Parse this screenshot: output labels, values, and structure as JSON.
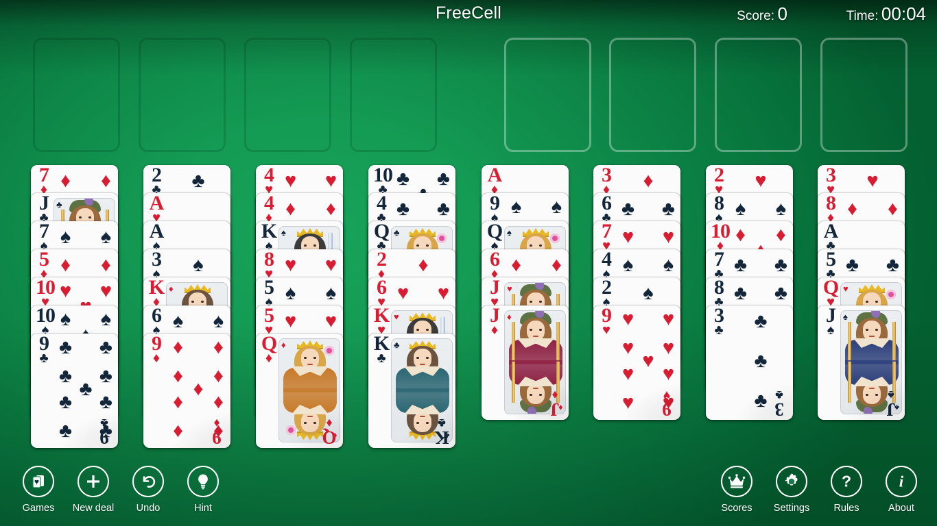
{
  "header": {
    "title": "FreeCell",
    "score_label": "Score:",
    "score_value": "0",
    "time_label": "Time:",
    "time_value": "00:04"
  },
  "colors": {
    "table_green": "#0d8546",
    "red_suit": "#d81c32",
    "black_suit": "#13263a",
    "card_face": "#fbfbfb",
    "foundation_outline": "rgba(255,255,255,0.34)",
    "freecell_outline": "rgba(0,0,0,0.13)"
  },
  "free_cells": [
    {
      "name": "free-cell-1",
      "card": null
    },
    {
      "name": "free-cell-2",
      "card": null
    },
    {
      "name": "free-cell-3",
      "card": null
    },
    {
      "name": "free-cell-4",
      "card": null
    }
  ],
  "foundations": [
    {
      "name": "foundation-1",
      "card": null
    },
    {
      "name": "foundation-2",
      "card": null
    },
    {
      "name": "foundation-3",
      "card": null
    },
    {
      "name": "foundation-4",
      "card": null
    }
  ],
  "tableau": [
    {
      "column": 1,
      "cards": [
        {
          "rank": "7",
          "suit": "diamonds"
        },
        {
          "rank": "J",
          "suit": "clubs"
        },
        {
          "rank": "7",
          "suit": "spades"
        },
        {
          "rank": "5",
          "suit": "diamonds"
        },
        {
          "rank": "10",
          "suit": "hearts"
        },
        {
          "rank": "10",
          "suit": "spades"
        },
        {
          "rank": "9",
          "suit": "clubs"
        }
      ]
    },
    {
      "column": 2,
      "cards": [
        {
          "rank": "2",
          "suit": "clubs"
        },
        {
          "rank": "A",
          "suit": "hearts"
        },
        {
          "rank": "A",
          "suit": "spades"
        },
        {
          "rank": "3",
          "suit": "spades"
        },
        {
          "rank": "K",
          "suit": "diamonds"
        },
        {
          "rank": "6",
          "suit": "spades"
        },
        {
          "rank": "9",
          "suit": "diamonds"
        }
      ]
    },
    {
      "column": 3,
      "cards": [
        {
          "rank": "4",
          "suit": "hearts"
        },
        {
          "rank": "4",
          "suit": "diamonds"
        },
        {
          "rank": "K",
          "suit": "spades"
        },
        {
          "rank": "8",
          "suit": "hearts"
        },
        {
          "rank": "5",
          "suit": "spades"
        },
        {
          "rank": "5",
          "suit": "hearts"
        },
        {
          "rank": "Q",
          "suit": "diamonds"
        }
      ]
    },
    {
      "column": 4,
      "cards": [
        {
          "rank": "10",
          "suit": "clubs"
        },
        {
          "rank": "4",
          "suit": "clubs"
        },
        {
          "rank": "Q",
          "suit": "clubs"
        },
        {
          "rank": "2",
          "suit": "diamonds"
        },
        {
          "rank": "6",
          "suit": "hearts"
        },
        {
          "rank": "K",
          "suit": "hearts"
        },
        {
          "rank": "K",
          "suit": "clubs"
        }
      ]
    },
    {
      "column": 5,
      "cards": [
        {
          "rank": "A",
          "suit": "diamonds"
        },
        {
          "rank": "9",
          "suit": "spades"
        },
        {
          "rank": "Q",
          "suit": "spades"
        },
        {
          "rank": "6",
          "suit": "diamonds"
        },
        {
          "rank": "J",
          "suit": "hearts"
        },
        {
          "rank": "J",
          "suit": "diamonds"
        }
      ]
    },
    {
      "column": 6,
      "cards": [
        {
          "rank": "3",
          "suit": "diamonds"
        },
        {
          "rank": "6",
          "suit": "clubs"
        },
        {
          "rank": "7",
          "suit": "hearts"
        },
        {
          "rank": "4",
          "suit": "spades"
        },
        {
          "rank": "2",
          "suit": "spades"
        },
        {
          "rank": "9",
          "suit": "hearts"
        }
      ]
    },
    {
      "column": 7,
      "cards": [
        {
          "rank": "2",
          "suit": "hearts"
        },
        {
          "rank": "8",
          "suit": "spades"
        },
        {
          "rank": "10",
          "suit": "diamonds"
        },
        {
          "rank": "7",
          "suit": "clubs"
        },
        {
          "rank": "8",
          "suit": "clubs"
        },
        {
          "rank": "3",
          "suit": "clubs"
        }
      ]
    },
    {
      "column": 8,
      "cards": [
        {
          "rank": "3",
          "suit": "hearts"
        },
        {
          "rank": "8",
          "suit": "diamonds"
        },
        {
          "rank": "A",
          "suit": "clubs"
        },
        {
          "rank": "5",
          "suit": "clubs"
        },
        {
          "rank": "Q",
          "suit": "hearts"
        },
        {
          "rank": "J",
          "suit": "spades"
        }
      ]
    }
  ],
  "toolbar_left": [
    {
      "id": "games",
      "label": "Games",
      "icon": "cards-icon"
    },
    {
      "id": "new-deal",
      "label": "New deal",
      "icon": "plus-icon"
    },
    {
      "id": "undo",
      "label": "Undo",
      "icon": "undo-arrow-icon"
    },
    {
      "id": "hint",
      "label": "Hint",
      "icon": "lightbulb-icon"
    }
  ],
  "toolbar_right": [
    {
      "id": "scores",
      "label": "Scores",
      "icon": "crown-icon"
    },
    {
      "id": "settings",
      "label": "Settings",
      "icon": "gear-icon"
    },
    {
      "id": "rules",
      "label": "Rules",
      "icon": "question-mark-icon"
    },
    {
      "id": "about",
      "label": "About",
      "icon": "info-icon"
    }
  ]
}
